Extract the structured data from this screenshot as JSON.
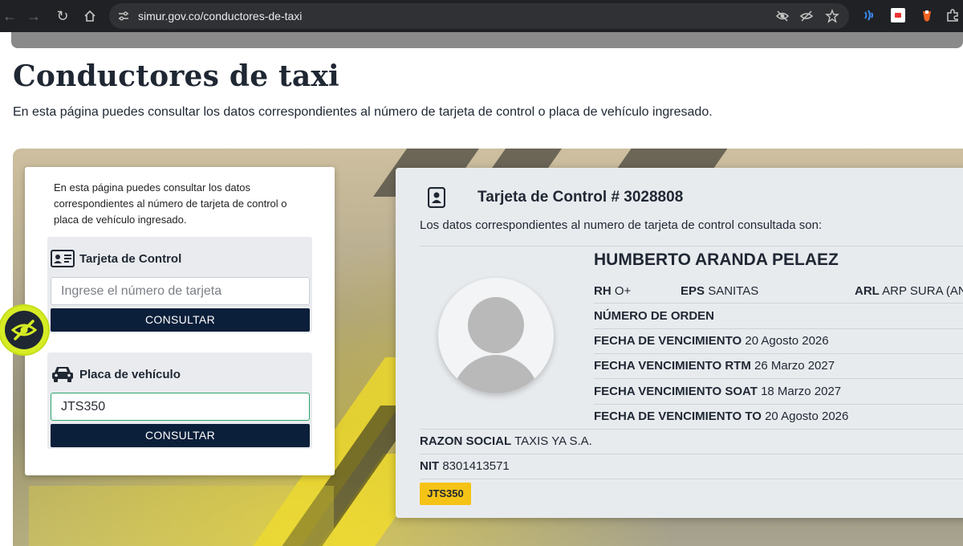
{
  "browser": {
    "url": "simur.gov.co/conductores-de-taxi"
  },
  "page": {
    "title": "Conductores de taxi",
    "description": "En esta página puedes consultar los datos correspondientes al número de tarjeta de control o placa de vehículo ingresado."
  },
  "search_panel": {
    "intro": "En esta página puedes consultar los datos correspondientes al número de tarjeta de control o placa de vehículo ingresado.",
    "control_card": {
      "title": "Tarjeta de Control",
      "placeholder": "Ingrese el número de tarjeta",
      "value": "",
      "button": "CONSULTAR"
    },
    "vehicle_plate": {
      "title": "Placa de vehículo",
      "value": "JTS350",
      "button": "CONSULTAR"
    }
  },
  "result": {
    "title": "Tarjeta de Control # 3028808",
    "subtitle": "Los datos correspondientes al numero de tarjeta de control consultada son:",
    "driver_name": "HUMBERTO ARANDA PELAEZ",
    "rh_label": "RH",
    "rh_value": "O+",
    "eps_label": "EPS",
    "eps_value": "SANITAS",
    "arl_label": "ARL",
    "arl_value": "ARP SURA (ANT",
    "order_label": "NÚMERO DE ORDEN",
    "order_value": "",
    "expiry_label": "FECHA DE VENCIMIENTO",
    "expiry_value": "20 Agosto 2026",
    "rtm_label": "FECHA VENCIMIENTO RTM",
    "rtm_value": "26 Marzo 2027",
    "soat_label": "FECHA VENCIMIENTO SOAT",
    "soat_value": "18 Marzo 2027",
    "to_label": "FECHA DE VENCIMIENTO TO",
    "to_value": "20 Agosto 2026",
    "company_label": "RAZON SOCIAL",
    "company_value": "TAXIS YA S.A.",
    "nit_label": "NIT",
    "nit_value": "8301413571",
    "plate": "JTS350"
  },
  "colors": {
    "navy": "#0b1f3a",
    "text": "#1f2733",
    "plate_yellow": "#f5c316",
    "a11y_yellow": "#d6ec24"
  }
}
